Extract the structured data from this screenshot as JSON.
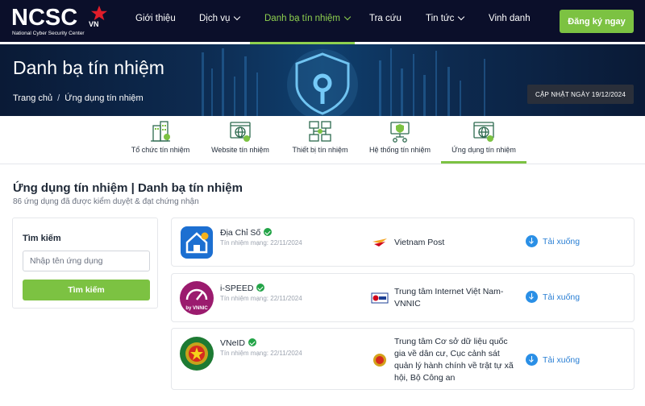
{
  "brand": {
    "logo_text": "NCSC",
    "logo_suffix": "VN",
    "logo_subtitle": "National Cyber Security Center"
  },
  "nav": {
    "items": [
      {
        "label": "Giới thiệu",
        "has_dropdown": false
      },
      {
        "label": "Dịch vụ",
        "has_dropdown": true
      },
      {
        "label": "Danh bạ tín nhiệm",
        "has_dropdown": true,
        "active": true
      },
      {
        "label": "Tra cứu",
        "has_dropdown": false
      },
      {
        "label": "Tin tức",
        "has_dropdown": true
      },
      {
        "label": "Vinh danh",
        "has_dropdown": false
      }
    ],
    "register_label": "Đăng ký ngay"
  },
  "banner": {
    "title": "Danh bạ tín nhiệm",
    "breadcrumb": [
      "Trang chủ",
      "Ứng dụng tín nhiệm"
    ],
    "breadcrumb_separator": "/",
    "update_label": "CẬP NHẬT NGÀY 19/12/2024"
  },
  "categories": [
    {
      "label": "Tổ chức tín nhiệm",
      "icon": "building-check-icon"
    },
    {
      "label": "Website tín nhiệm",
      "icon": "globe-window-icon"
    },
    {
      "label": "Thiết bị tín nhiệm",
      "icon": "device-network-icon"
    },
    {
      "label": "Hệ thống tín nhiệm",
      "icon": "shield-system-icon"
    },
    {
      "label": "Ứng dụng tín nhiệm",
      "icon": "globe-window-icon",
      "active": true
    }
  ],
  "main": {
    "heading": "Ứng dụng tín nhiệm | Danh bạ tín nhiệm",
    "subheading": "86 ứng dụng đã được kiểm duyệt & đạt chứng nhận"
  },
  "search": {
    "title": "Tìm kiếm",
    "placeholder": "Nhập tên ứng dụng",
    "button_label": "Tìm kiếm"
  },
  "apps": [
    {
      "name": "Địa Chỉ Số",
      "date": "Tín nhiệm mạng: 22/11/2024",
      "provider": "Vietnam Post",
      "download_label": "Tải xuống"
    },
    {
      "name": "i-SPEED",
      "date": "Tín nhiệm mạng: 22/11/2024",
      "provider": "Trung tâm Internet Việt Nam-VNNIC",
      "download_label": "Tải xuống",
      "logo_text": "by VNNIC"
    },
    {
      "name": "VNeID",
      "date": "Tín nhiệm mạng: 22/11/2024",
      "provider": "Trung tâm Cơ sở dữ liệu quốc gia về dân cư, Cục cảnh sát quản lý hành chính về trật tự xã hội, Bộ Công an",
      "download_label": "Tải xuống"
    }
  ],
  "colors": {
    "topbar": "#0b0f2a",
    "accent_green": "#7cc242",
    "nav_active": "#8fd14f",
    "link_blue": "#2a7fd4",
    "verified_green": "#22a447"
  }
}
